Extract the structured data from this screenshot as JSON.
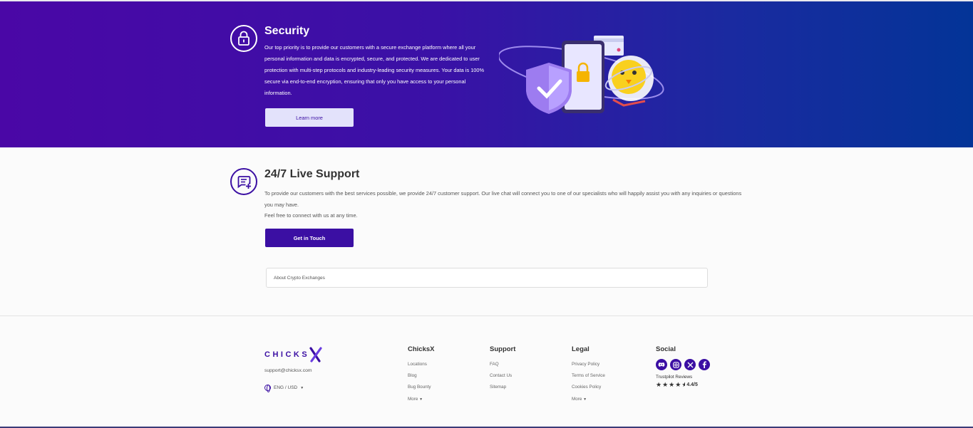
{
  "security": {
    "title": "Security",
    "body": "Our top priority is to provide our customers with a secure exchange platform where all your personal information and data is encrypted, secure, and protected. We are dedicated to user protection with multi-step protocols and industry-leading security measures. Your data is 100% secure via end-to-end encryption, ensuring that only you have access to your personal information.",
    "button": "Learn more",
    "icon": "lock-icon"
  },
  "support": {
    "title": "24/7 Live Support",
    "body1": "To provide our customers with the best services possible, we provide 24/7 customer support. Our live chat will connect you to one of our specialists who will happily assist you with any inquiries or questions you may have.",
    "body2": "Feel free to connect with us at any time.",
    "button": "Get in Touch",
    "icon": "chat-icon"
  },
  "accordion": {
    "label": "About Crypto Exchanges"
  },
  "footer": {
    "logo": "CHICKS",
    "email": "support@chicksx.com",
    "lang": "ENG / USD",
    "columns": [
      {
        "title": "ChicksX",
        "links": [
          "Locations",
          "Blog",
          "Bug Bounty",
          "More"
        ]
      },
      {
        "title": "Support",
        "links": [
          "FAQ",
          "Contact Us",
          "Sitemap"
        ]
      },
      {
        "title": "Legal",
        "links": [
          "Privacy Policy",
          "Terms of Service",
          "Cookies Policy",
          "More"
        ]
      }
    ],
    "social": {
      "title": "Social",
      "icons": [
        "discord-icon",
        "instagram-icon",
        "x-icon",
        "facebook-icon"
      ],
      "trustpilot_label": "Trustpilot Reviews",
      "rating": "4.4/5"
    }
  },
  "colors": {
    "brand": "#3b0fa3",
    "hero_start": "#4a07a6",
    "hero_end": "#033497",
    "button_light": "#e3e2fb"
  }
}
